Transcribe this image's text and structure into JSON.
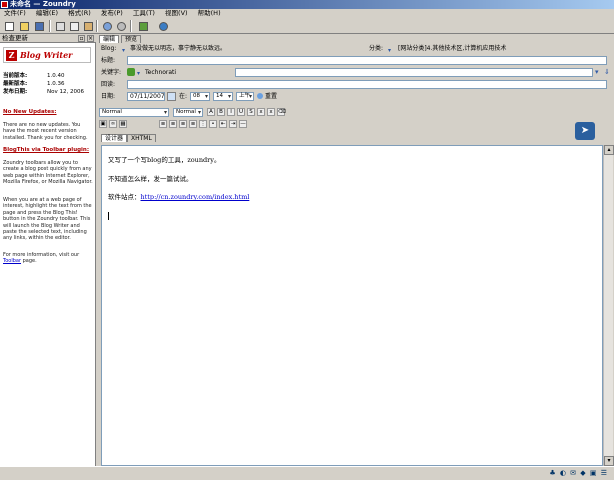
{
  "window": {
    "title": "未命名 — Zoundry"
  },
  "menu": [
    "文件(F)",
    "编辑(E)",
    "格式(R)",
    "发布(P)",
    "工具(T)",
    "视图(V)",
    "帮助(H)"
  ],
  "left_panel": {
    "title": "检查更新",
    "logo_letter": "Z",
    "logo_text": "Blog Writer",
    "versions": [
      {
        "label": "当前版本:",
        "value": "1.0.40"
      },
      {
        "label": "最新版本:",
        "value": "1.0.36"
      },
      {
        "label": "发布日期:",
        "value": "Nov 12, 2006"
      }
    ],
    "updates_heading": "No New Updates:",
    "updates_text": "There are no new updates. You have the most recent version installed. Thank you for checking.",
    "blogthis_heading": "BlogThis via Toolbar plugin:",
    "blogthis_text1": "Zoundry toolbars allow you to create a blog post quickly from any web page within Internet Explorer, Mozilla Firefox, or Mozilla Navigator.",
    "blogthis_text2": "When you are at a web page of interest, highlight the text from the page and press the Blog This! button in the Zoundry toolbar. This will launch the Blog Writer and paste the selected text, including any links, within the editor.",
    "more_info_text": "For more information, visit our",
    "more_info_link": "Toolbar",
    "more_info_tail": "page."
  },
  "editor": {
    "tabs": [
      "编辑",
      "预览"
    ],
    "blog_label": "Blog:",
    "blog_value": "事没做无以明志，事宁静无以致远。",
    "category_label": "分类:",
    "category_value": "[网站分类]4.其他技术区,计算机应用技术",
    "title_label": "标题:",
    "title_value": "",
    "keywords_label": "关键字:",
    "keywords_provider": "Technorati",
    "trackback_label": "回读:",
    "date_label": "日期:",
    "date_value": "07/11/2007",
    "time_label": "在:",
    "hour": "08",
    "minute": "14",
    "ampm": "上午",
    "reset_label": "重置",
    "style_select": "Normal",
    "font_select": "Normal",
    "mode_tabs": [
      "设计器",
      "XHTML"
    ],
    "content": {
      "line1": "又写了一个写blog的工具，zoundry。",
      "line2": "不知道怎么样，发一篇试试。",
      "line3_prefix": "软件站点：",
      "line3_link": "http://cn.zoundry.com/index.html"
    }
  },
  "colors": {
    "title_bar": "#0a246a",
    "link": "#0000cc",
    "brand_red": "#bb0000"
  }
}
